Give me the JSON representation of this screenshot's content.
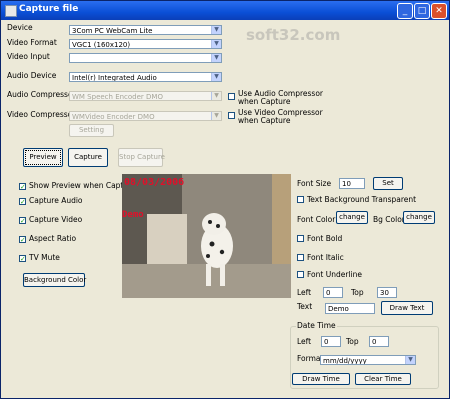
{
  "window": {
    "title": "Capture file",
    "watermark": "soft32.com"
  },
  "devices": {
    "device_label": "Device",
    "device_value": "3Com PC WebCam Lite",
    "format_label": "Video Format",
    "format_value": "VGC1 (160x120)",
    "input_label": "Video Input",
    "input_value": "",
    "audio_label": "Audio Device",
    "audio_value": "Intel(r) Integrated Audio",
    "acomp_label": "Audio Compressor",
    "acomp_value": "WM Speech Encoder DMO",
    "vcomp_label": "Video Compressor",
    "vcomp_value": "WMVideo Encoder DMO",
    "use_acomp": "Use Audio Compressor when Capture",
    "use_vcomp": "Use Video Compressor when Capture",
    "setting_button": "Setting"
  },
  "actions": {
    "preview": "Preview",
    "capture": "Capture",
    "stop": "Stop Capture"
  },
  "options": [
    {
      "label": "Show Preview when Capture",
      "checked": true
    },
    {
      "label": "Capture Audio",
      "checked": true
    },
    {
      "label": "Capture Video",
      "checked": true
    },
    {
      "label": "Aspect Ratio",
      "checked": true
    },
    {
      "label": "TV Mute",
      "checked": true
    }
  ],
  "background_button": "Background Color",
  "overlay": {
    "date": "08/03/2006",
    "text": "Demo"
  },
  "font": {
    "size_label": "Font Size",
    "size_value": "10",
    "set_button": "Set",
    "transparent_label": "Text Background Transparent",
    "color_label": "Font Color",
    "change_button": "change",
    "bg_label": "Bg Color",
    "bg_change_button": "change",
    "bold_label": "Font Bold",
    "italic_label": "Font Italic",
    "underline_label": "Font Underline"
  },
  "text_pos": {
    "left_label": "Left",
    "left_value": "0",
    "top_label": "Top",
    "top_value": "30",
    "text_label": "Text",
    "text_value": "Demo",
    "draw_button": "Draw Text"
  },
  "date_time": {
    "group_label": "Date Time",
    "left_label": "Left",
    "left_value": "0",
    "top_label": "Top",
    "top_value": "0",
    "format_label": "Format",
    "format_value": "mm/dd/yyyy",
    "draw_button": "Draw Time",
    "clear_button": "Clear Time"
  },
  "colors": {
    "title_bar": "#0a4fd6",
    "overlay_text": "#e0102a",
    "dialog_bg": "#ece9d8"
  }
}
